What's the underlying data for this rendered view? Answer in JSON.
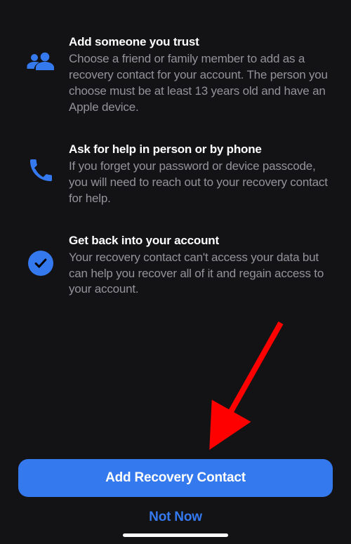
{
  "blocks": [
    {
      "title": "Add someone you trust",
      "body": "Choose a friend or family member to add as a recovery contact for your account. The person you choose must be at least 13 years old and have an Apple device."
    },
    {
      "title": "Ask for help in person or by phone",
      "body": "If you forget your password or device passcode, you will need to reach out to your recovery contact for help."
    },
    {
      "title": "Get back into your account",
      "body": "Your recovery contact can't access your data but can help you recover all of it and regain access to your account."
    }
  ],
  "buttons": {
    "primary": "Add Recovery Contact",
    "secondary": "Not Now"
  },
  "colors": {
    "accent": "#3579ef"
  }
}
